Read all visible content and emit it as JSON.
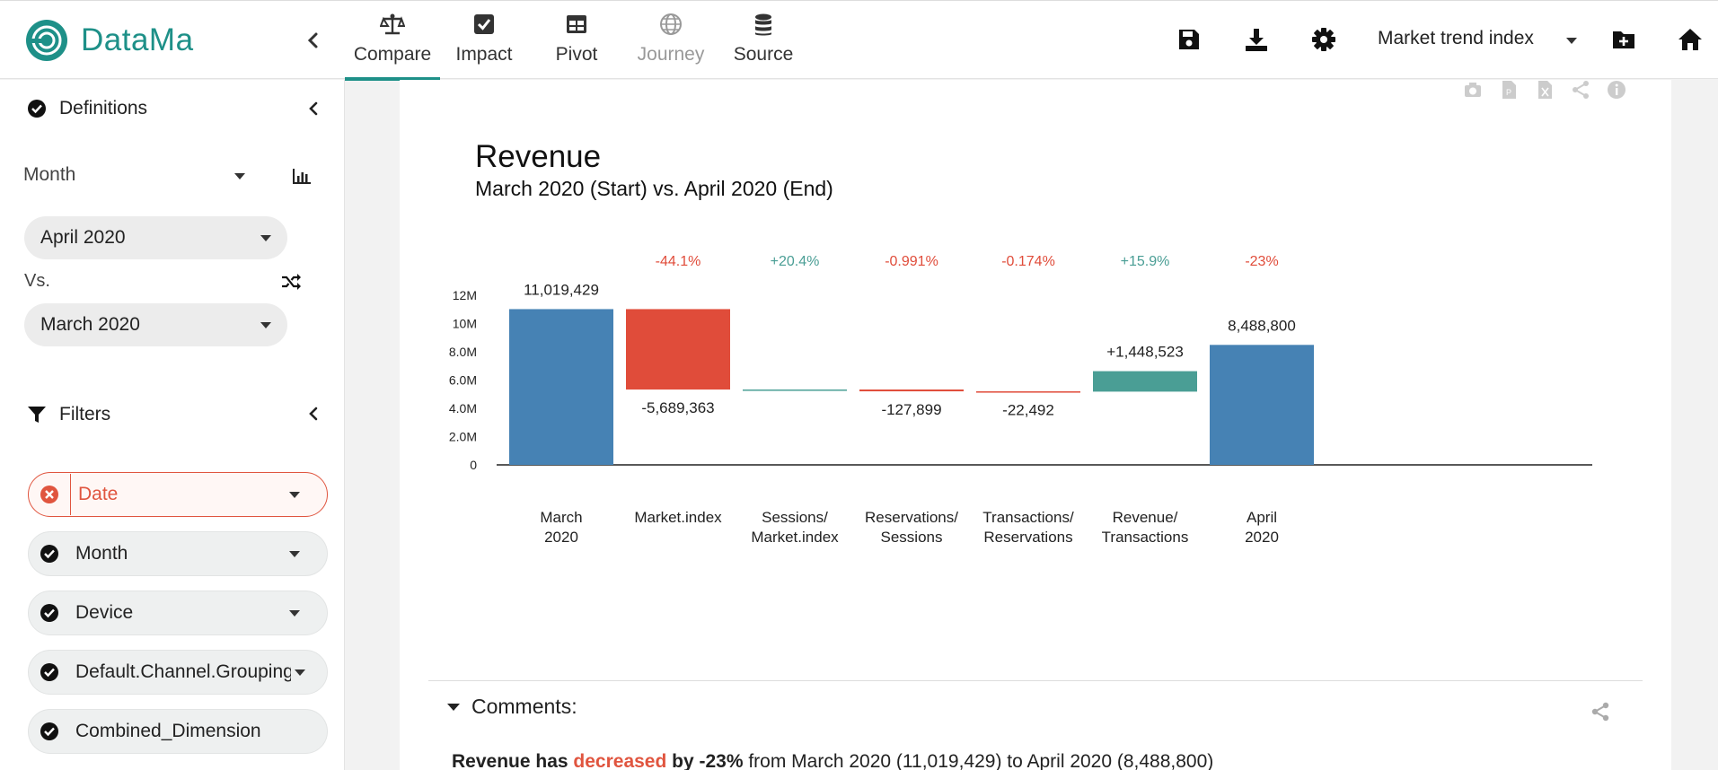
{
  "brand": {
    "name": "DataMa",
    "accent": "#1e9088"
  },
  "nav": {
    "tabs": [
      {
        "label": "Compare",
        "icon": "scale-icon",
        "active": true
      },
      {
        "label": "Impact",
        "icon": "checkbox-icon"
      },
      {
        "label": "Pivot",
        "icon": "table-icon"
      },
      {
        "label": "Journey",
        "icon": "globe-icon",
        "disabled": true
      },
      {
        "label": "Source",
        "icon": "database-icon"
      }
    ],
    "index_select": "Market trend index"
  },
  "sidebar": {
    "definitions_label": "Definitions",
    "granularity_label": "Month",
    "period_value": "April 2020",
    "vs_label": "Vs.",
    "compare_value": "March 2020",
    "filters_label": "Filters",
    "filters": [
      {
        "label": "Date",
        "state": "error"
      },
      {
        "label": "Month",
        "state": "ok"
      },
      {
        "label": "Device",
        "state": "ok"
      },
      {
        "label": "Default.Channel.Grouping",
        "state": "ok"
      },
      {
        "label": "Combined_Dimension",
        "state": "ok"
      }
    ]
  },
  "chart_data": {
    "type": "waterfall",
    "title": "Revenue",
    "subtitle": "March 2020 (Start) vs. April 2020 (End)",
    "ylim": [
      0,
      12000000
    ],
    "yticks": [
      "0",
      "2.0M",
      "4.0M",
      "6.0M",
      "8.0M",
      "10M",
      "12M"
    ],
    "ytick_values": [
      0,
      2000000,
      4000000,
      6000000,
      8000000,
      10000000,
      12000000
    ],
    "colors": {
      "total": "#4682b4",
      "negative": "#e04c3a",
      "positive": "#4a9e95"
    },
    "steps": [
      {
        "category": [
          "March",
          "2020"
        ],
        "kind": "total",
        "value": 11019429,
        "label": "11,019,429",
        "pct": ""
      },
      {
        "category": [
          "Market.index"
        ],
        "kind": "delta",
        "value": -5689363,
        "label": "-5,689,363",
        "pct": "-44.1%"
      },
      {
        "category": [
          "Sessions/",
          "Market.index"
        ],
        "kind": "delta",
        "value": 1129,
        "label": "",
        "pct": "+20.4%"
      },
      {
        "category": [
          "Reservations/",
          "Sessions"
        ],
        "kind": "delta",
        "value": -127899,
        "label": "-127,899",
        "pct": "-0.991%"
      },
      {
        "category": [
          "Transactions/",
          "Reservations"
        ],
        "kind": "delta",
        "value": -22492,
        "label": "-22,492",
        "pct": "-0.174%"
      },
      {
        "category": [
          "Revenue/",
          "Transactions"
        ],
        "kind": "delta",
        "value": 1448523,
        "label": "+1,448,523",
        "pct": "+15.9%"
      },
      {
        "category": [
          "April",
          "2020"
        ],
        "kind": "total",
        "value": 8488800,
        "label": "8,488,800",
        "pct": "-23%"
      }
    ]
  },
  "comments": {
    "heading": "Comments:",
    "metric": "Revenue",
    "has": " has ",
    "direction": "decreased",
    "by": " by -23%",
    "rest": " from March 2020 (11,019,429) to April 2020 (8,488,800)"
  }
}
